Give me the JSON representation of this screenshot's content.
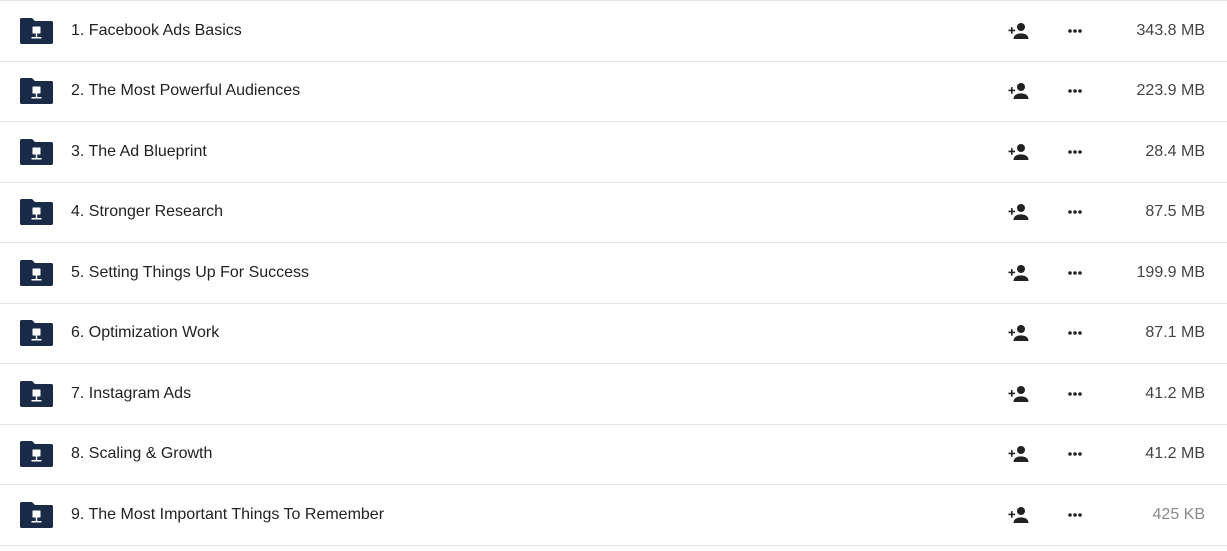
{
  "files": [
    {
      "name": "1. Facebook Ads Basics",
      "size": "343.8 MB",
      "icon": "shared-folder-icon",
      "share_icon": "add-person-icon",
      "menu_icon": "more-options-icon"
    },
    {
      "name": "2. The Most Powerful Audiences",
      "size": "223.9 MB",
      "icon": "shared-folder-icon",
      "share_icon": "add-person-icon",
      "menu_icon": "more-options-icon"
    },
    {
      "name": "3. The Ad Blueprint",
      "size": "28.4 MB",
      "icon": "shared-folder-icon",
      "share_icon": "add-person-icon",
      "menu_icon": "more-options-icon"
    },
    {
      "name": "4. Stronger Research",
      "size": "87.5 MB",
      "icon": "shared-folder-icon",
      "share_icon": "add-person-icon",
      "menu_icon": "more-options-icon"
    },
    {
      "name": "5. Setting Things Up For Success",
      "size": "199.9 MB",
      "icon": "shared-folder-icon",
      "share_icon": "add-person-icon",
      "menu_icon": "more-options-icon"
    },
    {
      "name": "6. Optimization Work",
      "size": "87.1 MB",
      "icon": "shared-folder-icon",
      "share_icon": "add-person-icon",
      "menu_icon": "more-options-icon"
    },
    {
      "name": "7. Instagram Ads",
      "size": "41.2 MB",
      "icon": "shared-folder-icon",
      "share_icon": "add-person-icon",
      "menu_icon": "more-options-icon"
    },
    {
      "name": "8. Scaling & Growth",
      "size": "41.2 MB",
      "icon": "shared-folder-icon",
      "share_icon": "add-person-icon",
      "menu_icon": "more-options-icon"
    },
    {
      "name": "9. The Most Important Things To Remember",
      "size": "425 KB",
      "icon": "shared-folder-icon",
      "share_icon": "add-person-icon",
      "menu_icon": "more-options-icon"
    }
  ],
  "colors": {
    "folder": "#1a2b48",
    "icon": "#222222",
    "divider": "#e4e4e4"
  }
}
